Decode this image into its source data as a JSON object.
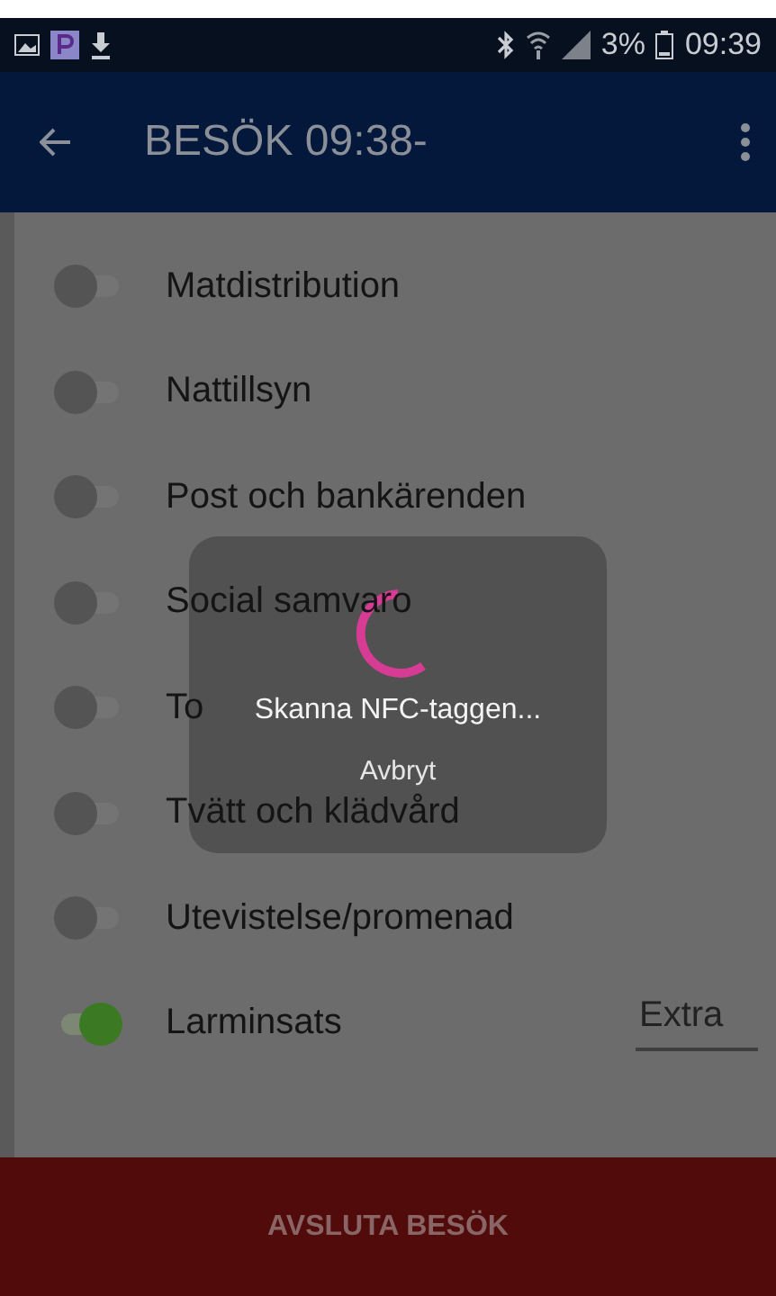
{
  "status_bar": {
    "battery_percent": "3%",
    "time": "09:39"
  },
  "app_bar": {
    "title": "BESÖK 09:38-"
  },
  "items": [
    {
      "label": "Matdistribution",
      "on": false
    },
    {
      "label": "Nattillsyn",
      "on": false
    },
    {
      "label": "Post och bankärenden",
      "on": false
    },
    {
      "label": "Social samvaro",
      "on": false
    },
    {
      "label": "To",
      "on": false
    },
    {
      "label": "Tvätt och klädvård",
      "on": false
    },
    {
      "label": "Utevistelse/promenad",
      "on": false
    },
    {
      "label": "Larminsats",
      "on": true,
      "value": "Extra"
    }
  ],
  "dialog": {
    "message": "Skanna NFC-taggen...",
    "cancel": "Avbryt"
  },
  "bottom_button": {
    "label": "AVSLUTA BESÖK"
  }
}
